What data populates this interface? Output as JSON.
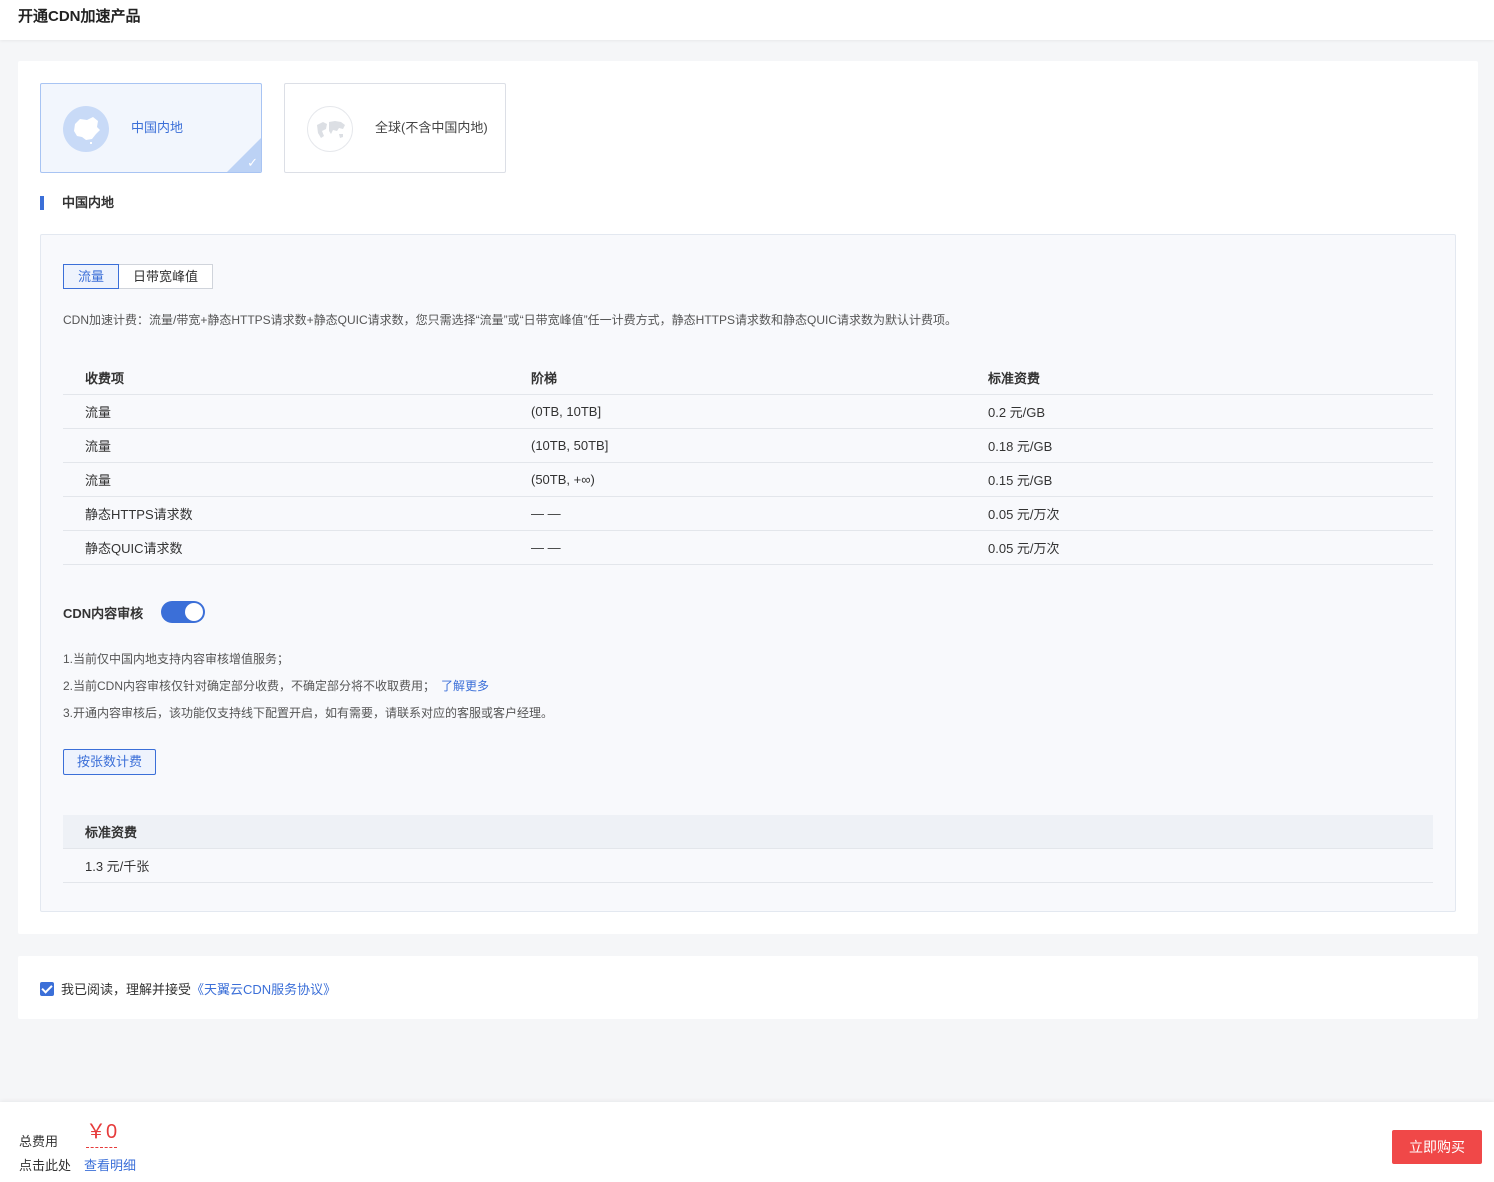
{
  "header": {
    "title": "开通CDN加速产品"
  },
  "regions": [
    {
      "label": "中国内地",
      "selected": true
    },
    {
      "label": "全球(不含中国内地)",
      "selected": false
    }
  ],
  "section": {
    "title": "中国内地"
  },
  "billing_tabs": [
    {
      "label": "流量",
      "active": true
    },
    {
      "label": "日带宽峰值",
      "active": false
    }
  ],
  "billing_desc": "CDN加速计费：流量/带宽+静态HTTPS请求数+静态QUIC请求数，您只需选择“流量”或“日带宽峰值”任一计费方式，静态HTTPS请求数和静态QUIC请求数为默认计费项。",
  "price_table": {
    "headers": [
      "收费项",
      "阶梯",
      "标准资费"
    ],
    "rows": [
      [
        "流量",
        "(0TB, 10TB]",
        "0.2 元/GB"
      ],
      [
        "流量",
        "(10TB, 50TB]",
        "0.18 元/GB"
      ],
      [
        "流量",
        "(50TB, +∞)",
        "0.15 元/GB"
      ],
      [
        "静态HTTPS请求数",
        "— —",
        "0.05 元/万次"
      ],
      [
        "静态QUIC请求数",
        "— —",
        "0.05 元/万次"
      ]
    ]
  },
  "content_review": {
    "label": "CDN内容审核",
    "enabled": true,
    "notes": [
      "1.当前仅中国内地支持内容审核增值服务；",
      "2.当前CDN内容审核仅针对确定部分收费，不确定部分将不收取费用；",
      "3.开通内容审核后，该功能仅支持线下配置开启，如有需要，请联系对应的客服或客户经理。"
    ],
    "learn_more": "了解更多",
    "billing_option": "按张数计费",
    "fee_table": {
      "header": "标准资费",
      "value": "1.3 元/千张"
    }
  },
  "agreement": {
    "checked": true,
    "text": "我已阅读，理解并接受",
    "link": "《天翼云CDN服务协议》"
  },
  "footer": {
    "total_label": "总费用",
    "total_value": "￥0",
    "click_label": "点击此处",
    "detail_link": "查看明细",
    "buy_button": "立即购买"
  },
  "colors": {
    "accent": "#3b6fd8",
    "buy": "#f04848",
    "price": "#e63b3b"
  }
}
